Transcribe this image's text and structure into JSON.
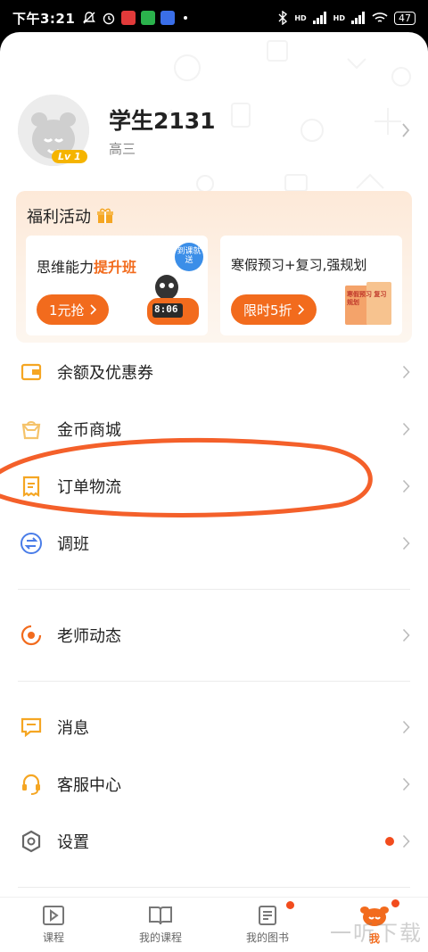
{
  "status_bar": {
    "time": "下午3:21",
    "battery": "47",
    "signal1": "HD",
    "signal2": "HD"
  },
  "profile": {
    "name": "学生2131",
    "grade": "高三",
    "level": "Lv 1"
  },
  "welfare": {
    "title": "福利活动",
    "cards": [
      {
        "title_prefix": "思维能力",
        "title_highlight": "提升班",
        "button": "1元抢",
        "badge": "到课就送",
        "clock_text": "8:06"
      },
      {
        "title": "寒假预习+复习,强规划",
        "button": "限时5折",
        "book_text": "寒假预习 复习规划"
      }
    ]
  },
  "menu": [
    {
      "label": "余额及优惠券",
      "icon": "wallet-icon"
    },
    {
      "label": "金币商城",
      "icon": "shopping-bag-icon"
    },
    {
      "label": "订单物流",
      "icon": "order-icon"
    },
    {
      "label": "调班",
      "icon": "swap-icon"
    },
    {
      "label": "老师动态",
      "icon": "teacher-feed-icon"
    },
    {
      "label": "消息",
      "icon": "message-icon"
    },
    {
      "label": "客服中心",
      "icon": "customer-service-icon"
    },
    {
      "label": "设置",
      "icon": "settings-icon",
      "has_dot": true
    }
  ],
  "tabs": [
    {
      "label": "课程",
      "icon": "play-icon"
    },
    {
      "label": "我的课程",
      "icon": "book-open-icon"
    },
    {
      "label": "我的图书",
      "icon": "document-icon",
      "has_dot": true
    },
    {
      "label": "我",
      "icon": "mascot-icon",
      "active": true,
      "has_dot": true
    }
  ],
  "watermark": "一听下载",
  "colors": {
    "accent": "#f26b1d",
    "dot": "#f24c1d",
    "annotation": "#f4602a",
    "welfare_bg": "#fde9d8"
  }
}
